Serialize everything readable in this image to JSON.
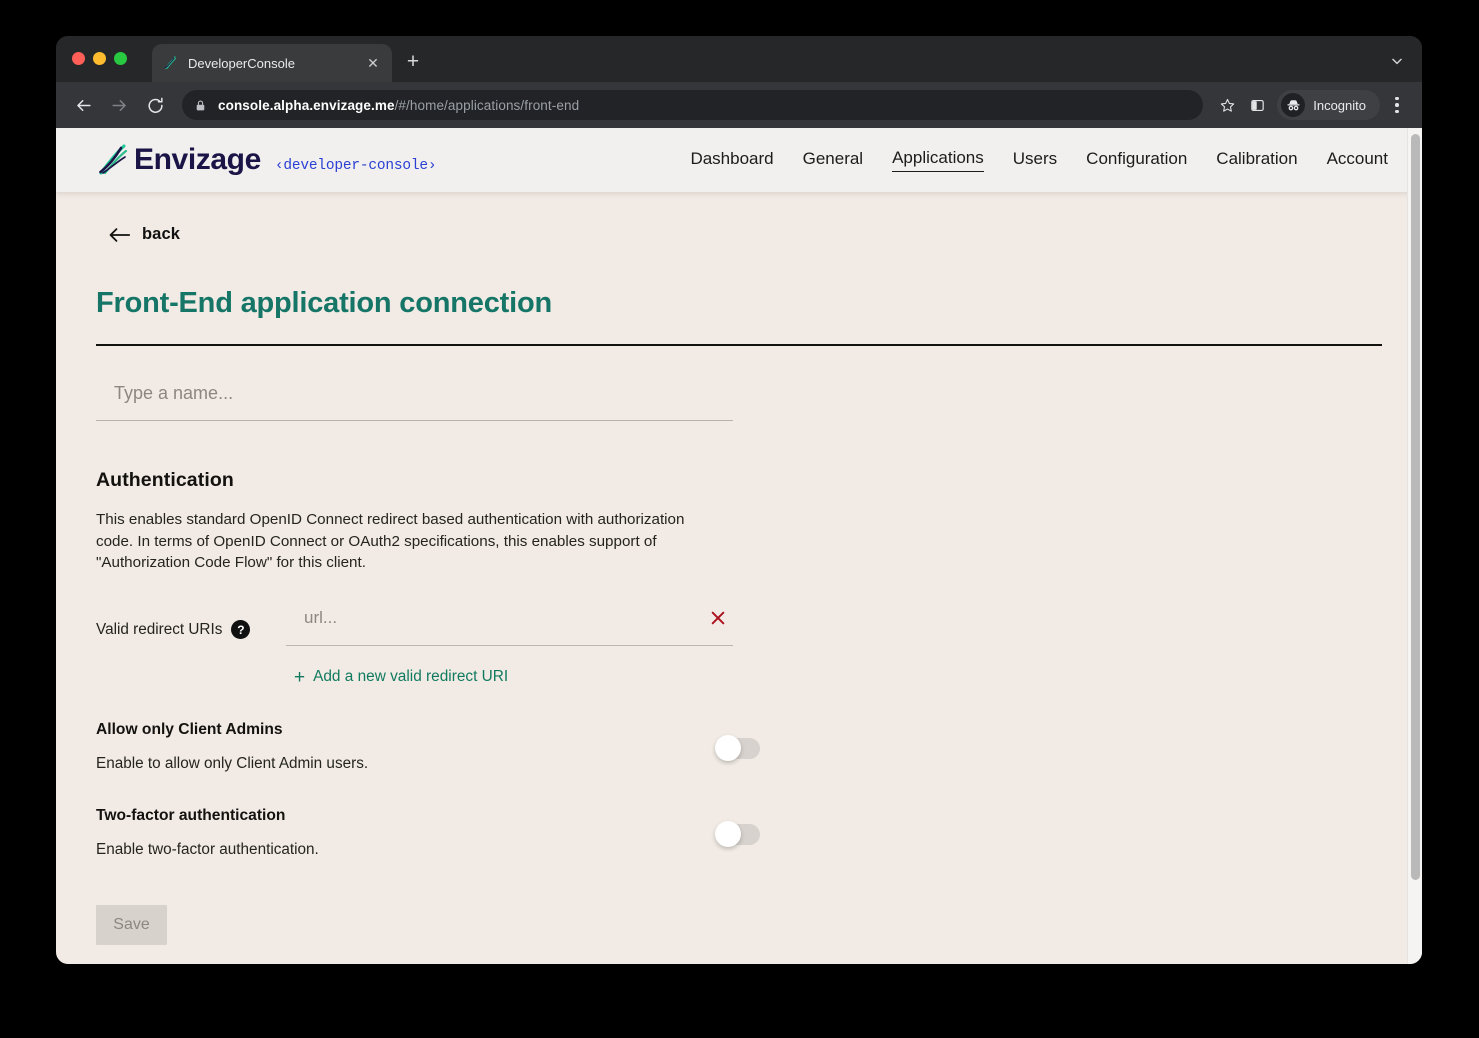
{
  "browser": {
    "tab": {
      "title": "DeveloperConsole",
      "favicon_icon": "envizage-leaf-icon",
      "close_icon": "close-icon"
    },
    "new_tab_label": "+",
    "tab_list_icon": "chevron-down-icon",
    "back_icon": "arrow-left-icon",
    "forward_icon": "arrow-right-icon",
    "reload_icon": "reload-icon",
    "omnibox": {
      "lock_icon": "lock-icon",
      "host": "console.alpha.envizage.me",
      "path": "/#/home/applications/front-end",
      "full_url": "console.alpha.envizage.me/#/home/applications/front-end"
    },
    "bookmark_icon": "star-icon",
    "sidepanel_icon": "side-panel-icon",
    "profile": {
      "label": "Incognito",
      "icon": "incognito-icon"
    },
    "menu_icon": "kebab-menu-icon"
  },
  "header": {
    "brand_name": "Envizage",
    "brand_sub": "‹developer-console›",
    "logo_icon": "envizage-leaf-icon",
    "nav": [
      {
        "label": "Dashboard",
        "active": false
      },
      {
        "label": "General",
        "active": false
      },
      {
        "label": "Applications",
        "active": true
      },
      {
        "label": "Users",
        "active": false
      },
      {
        "label": "Configuration",
        "active": false
      },
      {
        "label": "Calibration",
        "active": false
      },
      {
        "label": "Account",
        "active": false
      }
    ]
  },
  "main": {
    "back_label": "back",
    "back_icon": "arrow-left-icon",
    "page_title": "Front-End application connection",
    "name_input": {
      "value": "",
      "placeholder": "Type a name..."
    },
    "authentication": {
      "title": "Authentication",
      "description": "This enables standard OpenID Connect redirect based authentication with authorization code. In terms of OpenID Connect or OAuth2 specifications, this enables support of \"Authorization Code Flow\" for this client.",
      "redirect_uris": {
        "label": "Valid redirect URIs",
        "help_icon": "question-mark-icon",
        "help_glyph": "?",
        "rows": [
          {
            "value": "",
            "placeholder": "url...",
            "remove_icon": "close-x-icon",
            "remove_glyph": "✕"
          }
        ],
        "add_label": "Add a new valid redirect URI",
        "add_icon": "plus-icon",
        "add_glyph": "+"
      },
      "toggles": [
        {
          "title": "Allow only Client Admins",
          "description": "Enable to allow only Client Admin users.",
          "state": "off"
        },
        {
          "title": "Two-factor authentication",
          "description": "Enable two-factor authentication.",
          "state": "off"
        }
      ]
    },
    "save_label": "Save",
    "save_disabled": true
  },
  "colors": {
    "brand_navy": "#1b1447",
    "brand_blue": "#2b3fd4",
    "title_teal": "#157567",
    "link_green": "#107a5f",
    "danger_red": "#ad121f",
    "page_bg": "#f2ebe5",
    "header_bg": "#f1f0ee"
  }
}
